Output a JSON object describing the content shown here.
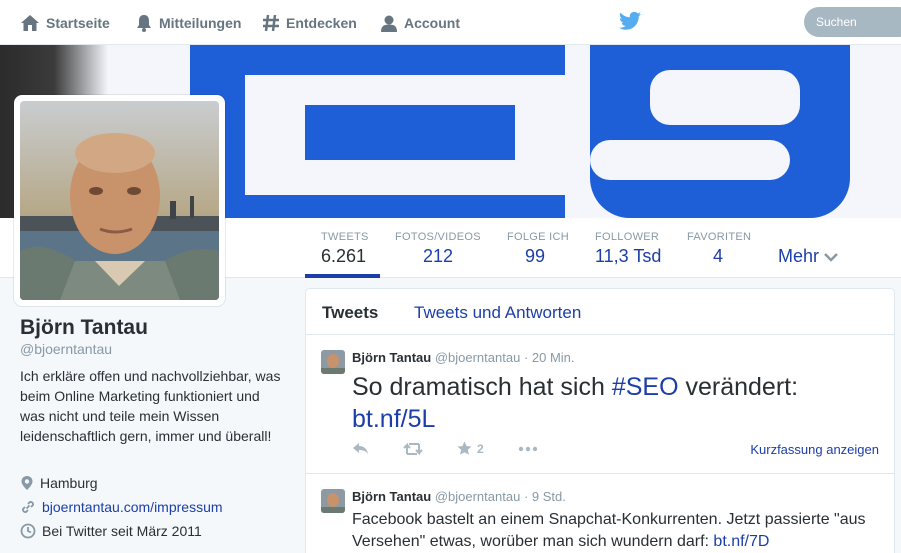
{
  "nav": {
    "home": "Startseite",
    "notifications": "Mitteilungen",
    "discover": "Entdecken",
    "account": "Account",
    "search_placeholder": "Suchen"
  },
  "stats": {
    "tweets": {
      "label": "TWEETS",
      "value": "6.261"
    },
    "photos": {
      "label": "FOTOS/VIDEOS",
      "value": "212"
    },
    "following": {
      "label": "FOLGE ICH",
      "value": "99"
    },
    "followers": {
      "label": "FOLLOWER",
      "value": "11,3 Tsd"
    },
    "favorites": {
      "label": "FAVORITEN",
      "value": "4"
    },
    "more": "Mehr"
  },
  "profile": {
    "name": "Björn Tantau",
    "handle": "@bjoerntantau",
    "bio": "Ich erkläre offen und nachvollziehbar, was beim Online Marketing funktioniert und was nicht und teile mein Wissen leidenschaftlich gern, immer und überall!",
    "location": "Hamburg",
    "url": "bjoerntantau.com/impressum",
    "joined": "Bei Twitter seit März 2011"
  },
  "timeline": {
    "tabs": [
      "Tweets",
      "Tweets und Antworten"
    ],
    "tweets": [
      {
        "name": "Björn Tantau",
        "handle": "@bjoerntantau",
        "time": "· 20 Min.",
        "text_before": "So dramatisch hat sich ",
        "hashtag": "#SEO",
        "text_after": " verändert:",
        "link": "bt.nf/5L",
        "favorites": "2",
        "summary": "Kurzfassung anzeigen"
      },
      {
        "name": "Björn Tantau",
        "handle": "@bjoerntantau",
        "time": "· 9 Std.",
        "text": "Facebook bastelt an einem Snapchat-Konkurrenten. Jetzt passierte \"aus Versehen\" etwas, worüber man sich wundern darf: ",
        "link": "bt.nf/7D"
      }
    ]
  },
  "colors": {
    "accent": "#1c3ea8",
    "muted": "#8899a6",
    "text": "#292f33",
    "twitter_blue": "#55acee"
  }
}
